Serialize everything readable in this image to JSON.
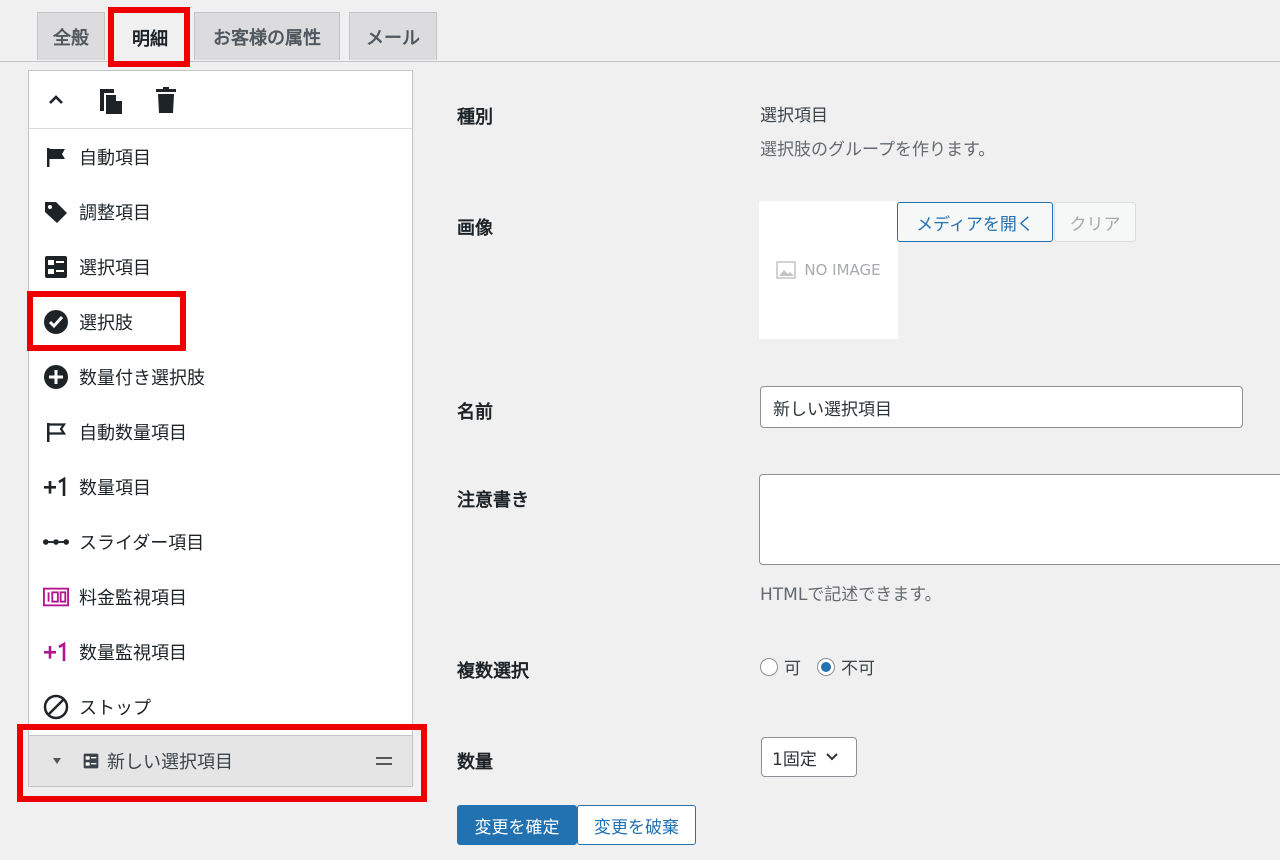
{
  "tabs": [
    {
      "label": "全般"
    },
    {
      "label": "明細"
    },
    {
      "label": "お客様の属性"
    },
    {
      "label": "メール"
    }
  ],
  "toolbar": {
    "collapse_icon": "chevron-up-icon",
    "copy_icon": "copy-icon",
    "delete_icon": "trash-icon"
  },
  "item_types": [
    {
      "label": "自動項目",
      "icon": "flag-filled-icon"
    },
    {
      "label": "調整項目",
      "icon": "tag-icon"
    },
    {
      "label": "選択項目",
      "icon": "list-box-icon"
    },
    {
      "label": "選択肢",
      "icon": "check-circle-icon"
    },
    {
      "label": "数量付き選択肢",
      "icon": "plus-circle-icon"
    },
    {
      "label": "自動数量項目",
      "icon": "flag-outline-icon"
    },
    {
      "label": "数量項目",
      "icon": "plus-one-icon"
    },
    {
      "label": "スライダー項目",
      "icon": "slider-icon"
    },
    {
      "label": "料金監視項目",
      "icon": "counter-100-icon"
    },
    {
      "label": "数量監視項目",
      "icon": "plus-one-magenta-icon"
    },
    {
      "label": "ストップ",
      "icon": "stop-icon"
    }
  ],
  "added_item": {
    "label": "新しい選択項目"
  },
  "form": {
    "type_label": "種別",
    "type_value": "選択項目",
    "type_desc": "選択肢のグループを作ります。",
    "image_label": "画像",
    "no_image_text": "NO IMAGE",
    "open_media_button": "メディアを開く",
    "clear_button": "クリア",
    "name_label": "名前",
    "name_value": "新しい選択項目",
    "note_label": "注意書き",
    "note_value": "",
    "note_desc": "HTMLで記述できます。",
    "multi_label": "複数選択",
    "multi_yes": "可",
    "multi_no": "不可",
    "multi_selected": "不可",
    "qty_label": "数量",
    "qty_value": "1固定",
    "confirm_button": "変更を確定",
    "discard_button": "変更を破棄"
  },
  "colors": {
    "accent": "#2271b1",
    "highlight": "#ee0000",
    "magenta": "#b3158f"
  }
}
